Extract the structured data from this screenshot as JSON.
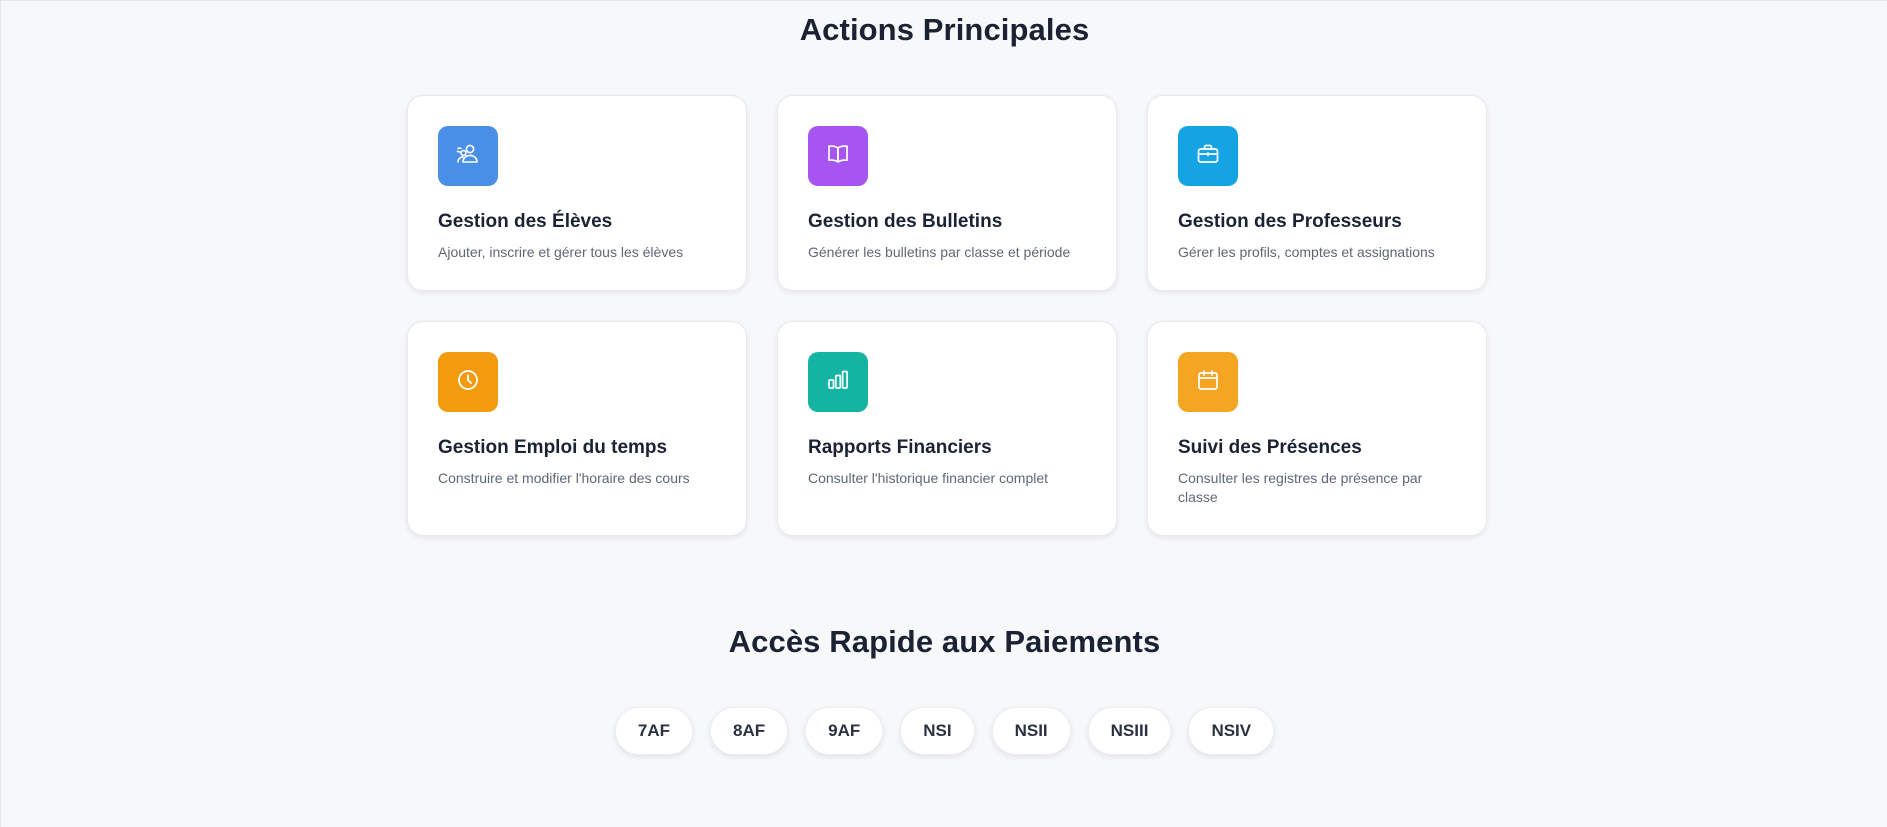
{
  "main_actions": {
    "title": "Actions Principales",
    "cards": [
      {
        "title": "Gestion des Élèves",
        "description": "Ajouter, inscrire et gérer tous les élèves",
        "icon": "users-icon",
        "color": "#4a8fe6"
      },
      {
        "title": "Gestion des Bulletins",
        "description": "Générer les bulletins par classe et période",
        "icon": "book-icon",
        "color": "#a655f0"
      },
      {
        "title": "Gestion des Professeurs",
        "description": "Gérer les profils, comptes et assignations",
        "icon": "briefcase-icon",
        "color": "#16a3e4"
      },
      {
        "title": "Gestion Emploi du temps",
        "description": "Construire et modifier l'horaire des cours",
        "icon": "clock-icon",
        "color": "#f29b0f"
      },
      {
        "title": "Rapports Financiers",
        "description": "Consulter l'historique financier complet",
        "icon": "bar-chart-icon",
        "color": "#14b4a2"
      },
      {
        "title": "Suivi des Présences",
        "description": "Consulter les registres de présence par classe",
        "icon": "calendar-icon",
        "color": "#f4a521"
      }
    ]
  },
  "quick_payments": {
    "title": "Accès Rapide aux Paiements",
    "classes": [
      "7AF",
      "8AF",
      "9AF",
      "NSI",
      "NSII",
      "NSIII",
      "NSIV"
    ]
  }
}
